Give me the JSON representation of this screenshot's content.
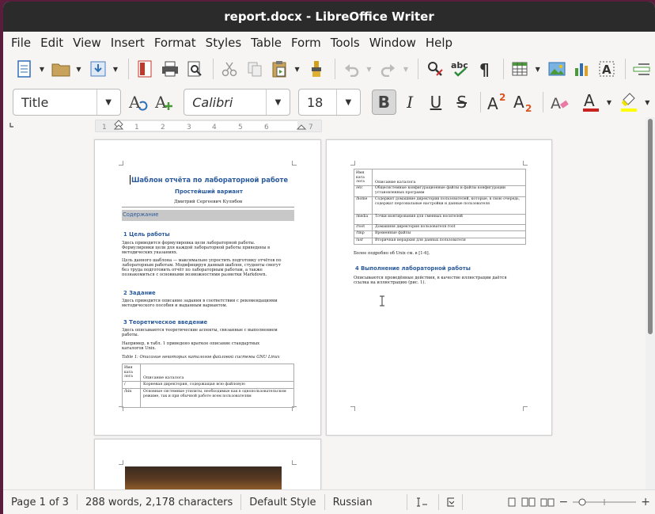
{
  "window": {
    "title": "report.docx - LibreOffice Writer"
  },
  "menu": [
    "File",
    "Edit",
    "View",
    "Insert",
    "Format",
    "Styles",
    "Table",
    "Form",
    "Tools",
    "Window",
    "Help"
  ],
  "format_bar": {
    "paragraph_style": "Title",
    "font_name": "Calibri",
    "font_size": "18"
  },
  "ruler": {
    "marks": [
      "1",
      "1",
      "2",
      "3",
      "4",
      "5",
      "6",
      "7"
    ]
  },
  "page1": {
    "title": "Шаблон отчёта по лабораторной работе",
    "subtitle": "Простейший вариант",
    "author": "Дмитрий Сергеевич Кулябов",
    "toc": "Содержание",
    "h1": "1    Цель работы",
    "p1a": "Здесь приводится формулировка цели лабораторной работы.",
    "p1b": "Формулировки цели для каждой лабораторной работы приведены в",
    "p1c": "методических указаниях.",
    "p2a": "Цель данного шаблона — максимально упростить подготовку отчётов по",
    "p2b": "лабораторным работам. Модифицируя данный шаблон, студенты смогут",
    "p2c": "без труда подготовить отчёт по лабораторным работам, а также",
    "p2d": "познакомиться с основными возможностями разметки Markdown.",
    "h2": "2    Задание",
    "p3a": "Здесь приводится описание задания в соответствии с рекомендациями",
    "p3b": "методического пособия и выданным вариантом.",
    "h3": "3    Теоретическое введение",
    "p4a": "Здесь описываются теоретические аспекты, связанные с выполнением",
    "p4b": "работы.",
    "p5a": "Например, в табл. 1 приведено краткое описание стандартных",
    "p5b": "каталогов Unix.",
    "caption": "Table 1: Описание некоторых каталогов файловой системы GNU Linux",
    "table": {
      "col1_header": "Имя ката лога",
      "col2_header": "Описание каталога",
      "rows": [
        {
          "name": "/",
          "desc": "Корневая директория, содержащая всю файловую"
        },
        {
          "name": "/bin",
          "desc": "Основные системные утилиты, необходимые как в однопользовательском режиме, так и при обычной работе всем пользователям"
        }
      ]
    }
  },
  "page2": {
    "table": {
      "col1_header": "Имя ката лога",
      "col2_header": "Описание каталога",
      "rows": [
        {
          "name": "/etc",
          "desc": "Общесистемные конфигурационные файлы и файлы конфигурации установленных программ"
        },
        {
          "name": "/home",
          "desc": "Содержит домашние директории пользователей, которые, в свою очередь, содержат персональные настройки и данные пользователя"
        },
        {
          "name": "/media",
          "desc": "Точки монтирования для сменных носителей"
        },
        {
          "name": "/root",
          "desc": "Домашняя директория пользователя root"
        },
        {
          "name": "/tmp",
          "desc": "Временные файлы"
        },
        {
          "name": "/usr",
          "desc": "Вторичная иерархия для данных пользователя"
        }
      ]
    },
    "more": "Более подробно об Unix см. в [1-6].",
    "h4": "4    Выполнение лабораторной работы",
    "p6a": "Описываются проведённые действия, в качестве иллюстрации даётся",
    "p6b": "ссылка на иллюстрацию (рис. 1)."
  },
  "status": {
    "page": "Page 1 of 3",
    "words": "288 words, 2,178 characters",
    "style": "Default Style",
    "language": "Russian"
  },
  "colors": {
    "heading": "#2a5a9b",
    "titlebar": "#2b2b2b",
    "desktop": "#5a1e3c"
  }
}
